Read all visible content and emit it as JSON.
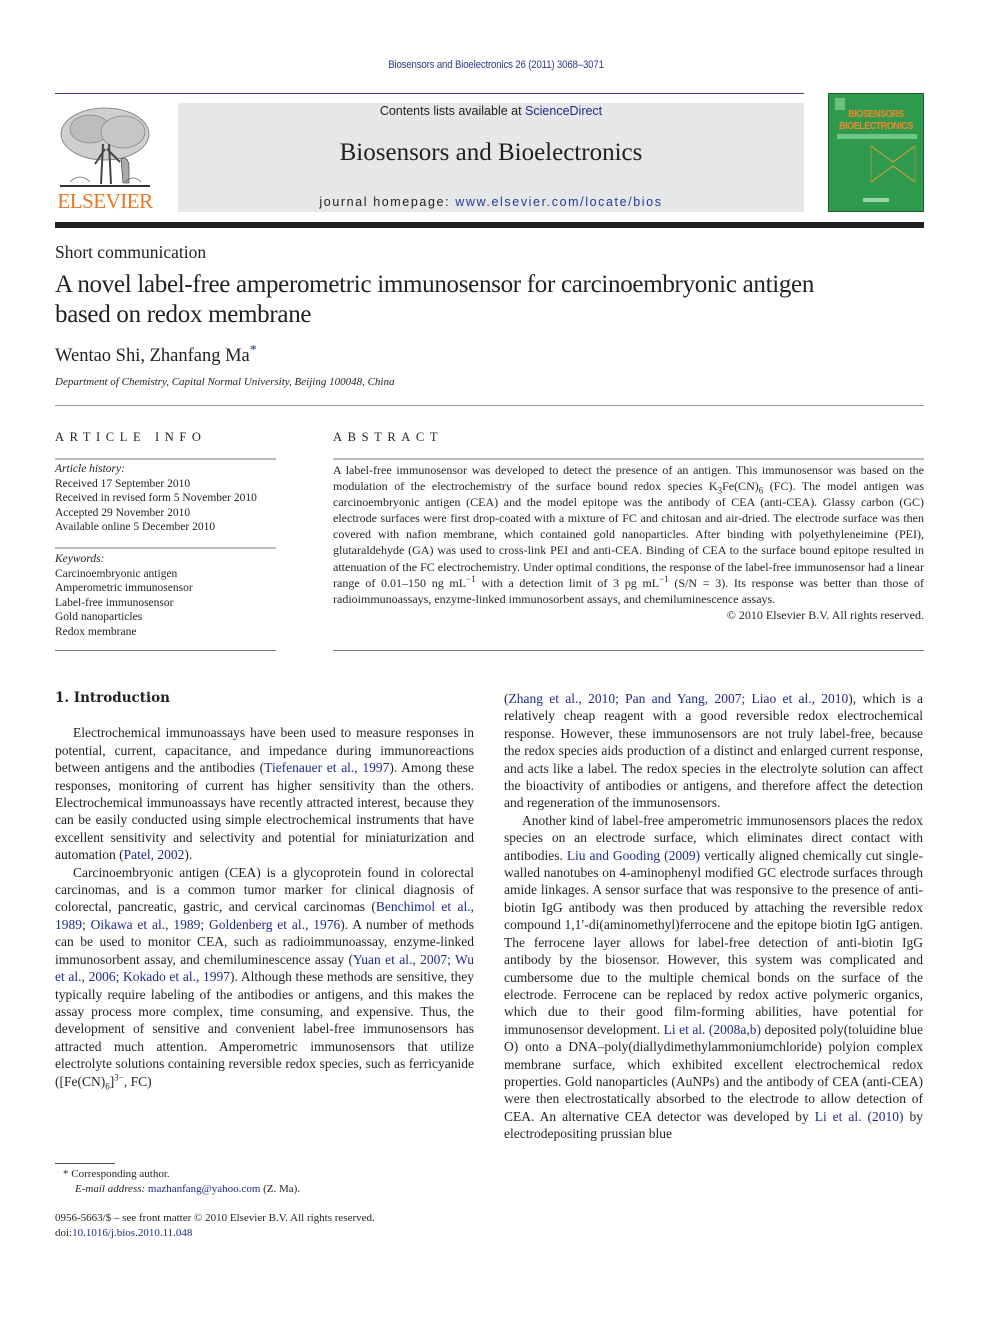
{
  "header": {
    "running_head": "Biosensors and Bioelectronics 26 (2011) 3068–3071",
    "publisher_logo_text": "ELSEVIER",
    "contents_prefix": "Contents lists available at ",
    "contents_link": "ScienceDirect",
    "journal_name": "Biosensors and Bioelectronics",
    "homepage_prefix": "journal homepage: ",
    "homepage_link": "www.elsevier.com/locate/bios",
    "cover_title_line1": "BIOSENSORS",
    "cover_title_line2": "BIOELECTRONICS",
    "colors": {
      "publisher_orange": "#e87722",
      "cover_green": "#2f9a4e",
      "link_blue": "#1f2b8a",
      "banner_gray": "#e6e7e8"
    }
  },
  "article": {
    "section_type": "Short communication",
    "title": "A novel label-free amperometric immunosensor for carcinoembryonic antigen based on redox membrane",
    "authors": "Wentao Shi, Zhanfang Ma",
    "author_mark": "*",
    "affiliation": "Department of Chemistry, Capital Normal University, Beijing 100048, China"
  },
  "article_info": {
    "heading": "ARTICLE INFO",
    "history_label": "Article history:",
    "history": [
      "Received 17 September 2010",
      "Received in revised form 5 November 2010",
      "Accepted 29 November 2010",
      "Available online 5 December 2010"
    ],
    "keywords_label": "Keywords:",
    "keywords": [
      "Carcinoembryonic antigen",
      "Amperometric immunosensor",
      "Label-free immunosensor",
      "Gold nanoparticles",
      "Redox membrane"
    ]
  },
  "abstract": {
    "heading": "ABSTRACT",
    "text_a": "A label-free immunosensor was developed to detect the presence of an antigen. This immunosensor was based on the modulation of the electrochemistry of the surface bound redox species K",
    "sub_3": "3",
    "text_b": "Fe(CN)",
    "sub_6": "6",
    "text_c": " (FC). The model antigen was carcinoembryonic antigen (CEA) and the model epitope was the antibody of CEA (anti-CEA). Glassy carbon (GC) electrode surfaces were first drop-coated with a mixture of FC and chitosan and air-dried. The electrode surface was then covered with nafion membrane, which contained gold nanoparticles. After binding with polyethyleneimine (PEI), glutaraldehyde (GA) was used to cross-link PEI and anti-CEA. Binding of CEA to the surface bound epitope resulted in attenuation of the FC electrochemistry. Under optimal conditions, the response of the label-free immunosensor had a linear range of 0.01–150 ng mL",
    "sup_1": "−1",
    "text_d": " with a detection limit of 3 pg mL",
    "sup_2": "−1",
    "text_e": " (S/N = 3). Its response was better than those of radioimmunoassays, enzyme-linked immunosorbent assays, and chemiluminescence assays.",
    "copyright": "© 2010 Elsevier B.V. All rights reserved."
  },
  "body": {
    "section_heading": "1.  Introduction",
    "p1_a": "Electrochemical immunoassays have been used to measure responses in potential, current, capacitance, and impedance during immunoreactions between antigens and the antibodies (",
    "p1_ref1": "Tiefenauer et al., 1997",
    "p1_b": "). Among these responses, monitoring of current has higher sensitivity than the others. Electrochemical immunoassays have recently attracted interest, because they can be easily conducted using simple electrochemical instruments that have excellent sensitivity and selectivity and potential for miniaturization and automation (",
    "p1_ref2": "Patel, 2002",
    "p1_c": ").",
    "p2_a": "Carcinoembryonic antigen (CEA) is a glycoprotein found in colorectal carcinomas, and is a common tumor marker for clinical diagnosis of colorectal, pancreatic, gastric, and cervical carcinomas (",
    "p2_ref1": "Benchimol et al., 1989; Oikawa et al., 1989; Goldenberg et al., 1976",
    "p2_b": "). A number of methods can be used to monitor CEA, such as radioimmunoassay, enzyme-linked immunosorbent assay, and chemiluminescence assay (",
    "p2_ref2": "Yuan et al., 2007; Wu et al., 2006; Kokado et al., 1997",
    "p2_c": "). Although these methods are sensitive, they typically require labeling of the antibodies or antigens, and this makes the assay process more complex, time consuming, and expensive. Thus, the development of sensitive and convenient label-free immunosensors has attracted much attention. Amperometric immunosensors that utilize electrolyte solutions containing reversible redox species, such as ferricyanide ([Fe(CN)",
    "p2_sub": "6",
    "p2_d": "]",
    "p2_sup": "3−",
    "p2_e": ", FC)",
    "p3_ref1": "Zhang et al., 2010; Pan and Yang, 2007; Liao et al., 2010",
    "p3_a": "), which is a relatively cheap reagent with a good reversible redox electrochemical response. However, these immunosensors are not truly label-free, because the redox species aids production of a distinct and enlarged current response, and acts like a label. The redox species in the electrolyte solution can affect the bioactivity of antibodies or antigens, and therefore affect the detection and regeneration of the immunosensors.",
    "p4_a": "Another kind of label-free amperometric immunosensors places the redox species on an electrode surface, which eliminates direct contact with antibodies. ",
    "p4_ref1": "Liu and Gooding (2009)",
    "p4_b": " vertically aligned chemically cut single-walled nanotubes on 4-aminophenyl modified GC electrode surfaces through amide linkages. A sensor surface that was responsive to the presence of anti-biotin IgG antibody was then produced by attaching the reversible redox compound 1,1′-di(aminomethyl)ferrocene and the epitope biotin IgG antigen. The ferrocene layer allows for label-free detection of anti-biotin IgG antibody by the biosensor. However, this system was complicated and cumbersome due to the multiple chemical bonds on the surface of the electrode. Ferrocene can be replaced by redox active polymeric organics, which due to their good film-forming abilities, have potential for immunosensor development. ",
    "p4_ref2": "Li et al. (2008a,b)",
    "p4_c": " deposited poly(toluidine blue O) onto a DNA–poly(diallydimethylammoniumchloride) polyion complex membrane surface, which exhibited excellent electrochemical redox properties. Gold nanoparticles (AuNPs) and the antibody of CEA (anti-CEA) were then electrostatically absorbed to the electrode to allow detection of CEA. An alternative CEA detector was developed by ",
    "p4_ref3": "Li et al. (2010)",
    "p4_d": " by electrodepositing prussian blue"
  },
  "footnote": {
    "mark": "*",
    "corresponding": " Corresponding author.",
    "email_label": "E-mail address: ",
    "email": "mazhanfang@yahoo.com",
    "email_suffix": " (Z. Ma).",
    "issn_line": "0956-5663/$ – see front matter © 2010 Elsevier B.V. All rights reserved.",
    "doi_prefix": "doi:",
    "doi": "10.1016/j.bios.2010.11.048"
  }
}
